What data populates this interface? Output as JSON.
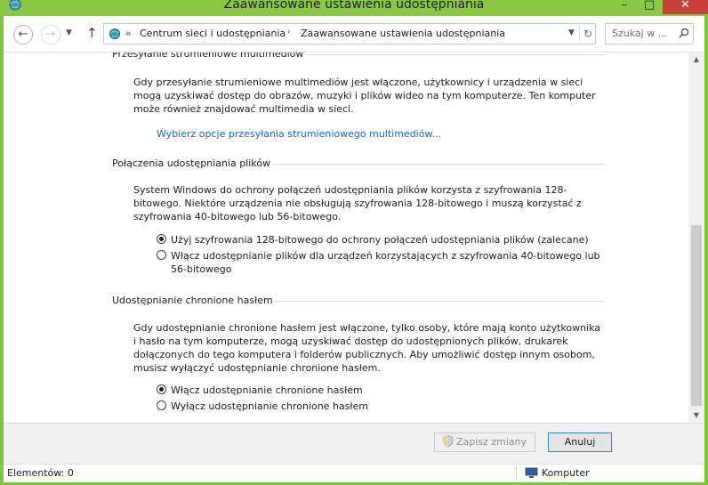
{
  "window": {
    "title": "Zaawansowane ustawienia udostępniania",
    "minimize": "–",
    "maximize": "□",
    "close": "✕"
  },
  "nav": {
    "back": "←",
    "forward": "→",
    "history": "▼",
    "up": "↑",
    "address_prefix": "«",
    "crumbs": [
      "Centrum sieci i udostępniania",
      "Zaawansowane ustawienia udostępniania"
    ],
    "crumb_separator": "›",
    "dropdown": "▼",
    "refresh": "↻",
    "search_placeholder": "Szukaj w ..."
  },
  "sections": [
    {
      "heading": "Przesyłanie strumieniowe multimediów",
      "text": "Gdy przesyłanie strumieniowe multimediów jest włączone, użytkownicy i urządzenia w sieci mogą uzyskiwać dostęp do obrazów, muzyki i plików wideo na tym komputerze. Ten komputer może również znajdować multimedia w sieci.",
      "link": "Wybierz opcje przesyłania strumieniowego multimediów..."
    },
    {
      "heading": "Połączenia udostępniania plików",
      "text": "System Windows do ochrony połączeń udostępniania plików korzysta z szyfrowania 128-bitowego. Niektóre urządzenia nie obsługują szyfrowania 128-bitowego i muszą korzystać z szyfrowania 40-bitowego lub 56-bitowego.",
      "options": [
        {
          "label": "Użyj szyfrowania 128-bitowego do ochrony połączeń udostępniania plików (zalecane)",
          "selected": true
        },
        {
          "label_line1": "Włącz udostępnianie plików dla urządzeń korzystających z szyfrowania 40-bitowego lub",
          "label_line2": "56-bitowego",
          "selected": false
        }
      ]
    },
    {
      "heading": "Udostępnianie chronione hasłem",
      "text": "Gdy udostępnianie chronione hasłem jest włączone, tylko osoby, które mają konto użytkownika i hasło na tym komputerze, mogą uzyskiwać dostęp do udostępnionych plików, drukarek dołączonych do tego komputera i folderów publicznych. Aby umożliwić dostęp innym osobom, musisz wyłączyć udostępnianie chronione hasłem.",
      "options": [
        {
          "label": "Włącz udostępnianie chronione hasłem",
          "selected": true
        },
        {
          "label": "Wyłącz udostępnianie chronione hasłem",
          "selected": false
        }
      ]
    }
  ],
  "scrollbar": {
    "up": "▲",
    "down": "▼"
  },
  "buttons": {
    "save": "Zapisz zmiany",
    "save_enabled": false,
    "cancel": "Anuluj"
  },
  "status": {
    "items": "Elementów: 0",
    "location": "Komputer"
  },
  "colors": {
    "titlebar": "#8ac744",
    "link": "#1a63c9",
    "close": "#c7413a"
  }
}
